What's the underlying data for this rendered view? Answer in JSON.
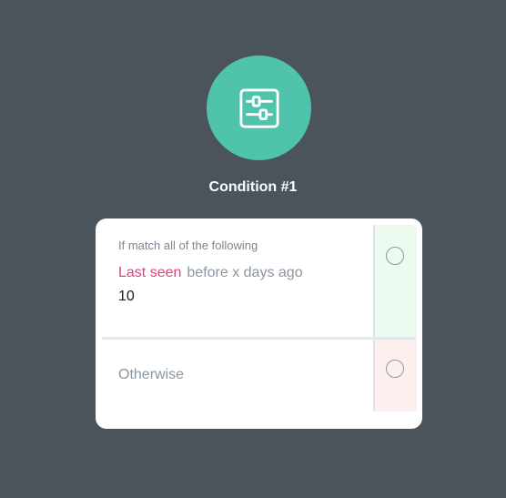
{
  "node": {
    "icon": "sliders-icon",
    "title": "Condition #1"
  },
  "branches": {
    "match": {
      "heading": "If match all of the following",
      "condition": {
        "field": "Last seen",
        "operator": "before x days ago",
        "value": "10"
      }
    },
    "otherwise": {
      "label": "Otherwise"
    }
  },
  "colors": {
    "background": "#4a545a",
    "icon_circle": "#4fc3ab",
    "field_highlight": "#e23f84",
    "yes_strip": "#ecfaef",
    "no_strip": "#fcefee"
  }
}
